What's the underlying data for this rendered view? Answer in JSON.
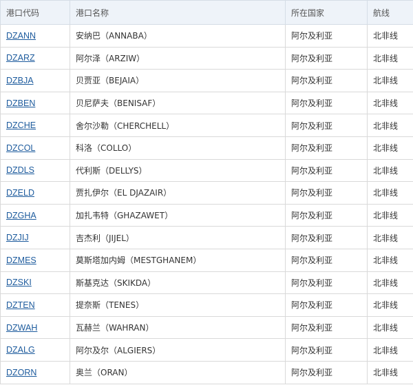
{
  "table": {
    "headers": {
      "code": "港口代码",
      "name": "港口名称",
      "country": "所在国家",
      "route": "航线"
    },
    "rows": [
      {
        "code": "DZANN",
        "name": "安纳巴（ANNABA）",
        "country": "阿尔及利亚",
        "route": "北非线"
      },
      {
        "code": "DZARZ",
        "name": "阿尔泽（ARZIW）",
        "country": "阿尔及利亚",
        "route": "北非线"
      },
      {
        "code": "DZBJA",
        "name": "贝贾亚（BEJAIA）",
        "country": "阿尔及利亚",
        "route": "北非线"
      },
      {
        "code": "DZBEN",
        "name": "贝尼萨夫（BENISAF）",
        "country": "阿尔及利亚",
        "route": "北非线"
      },
      {
        "code": "DZCHE",
        "name": "舍尔沙勒（CHERCHELL）",
        "country": "阿尔及利亚",
        "route": "北非线"
      },
      {
        "code": "DZCOL",
        "name": "科洛（COLLO）",
        "country": "阿尔及利亚",
        "route": "北非线"
      },
      {
        "code": "DZDLS",
        "name": "代利斯（DELLYS）",
        "country": "阿尔及利亚",
        "route": "北非线"
      },
      {
        "code": "DZELD",
        "name": "贾扎伊尔（EL DJAZAIR）",
        "country": "阿尔及利亚",
        "route": "北非线"
      },
      {
        "code": "DZGHA",
        "name": "加扎韦特（GHAZAWET）",
        "country": "阿尔及利亚",
        "route": "北非线"
      },
      {
        "code": "DZJIJ",
        "name": "吉杰利（JIJEL）",
        "country": "阿尔及利亚",
        "route": "北非线"
      },
      {
        "code": "DZMES",
        "name": "莫斯塔加内姆（MESTGHANEM）",
        "country": "阿尔及利亚",
        "route": "北非线"
      },
      {
        "code": "DZSKI",
        "name": "斯基克达（SKIKDA）",
        "country": "阿尔及利亚",
        "route": "北非线"
      },
      {
        "code": "DZTEN",
        "name": "提奈斯（TENES）",
        "country": "阿尔及利亚",
        "route": "北非线"
      },
      {
        "code": "DZWAH",
        "name": "瓦赫兰（WAHRAN）",
        "country": "阿尔及利亚",
        "route": "北非线"
      },
      {
        "code": "DZALG",
        "name": "阿尔及尔（ALGIERS）",
        "country": "阿尔及利亚",
        "route": "北非线"
      },
      {
        "code": "DZORN",
        "name": "奥兰（ORAN）",
        "country": "阿尔及利亚",
        "route": "北非线"
      }
    ]
  }
}
